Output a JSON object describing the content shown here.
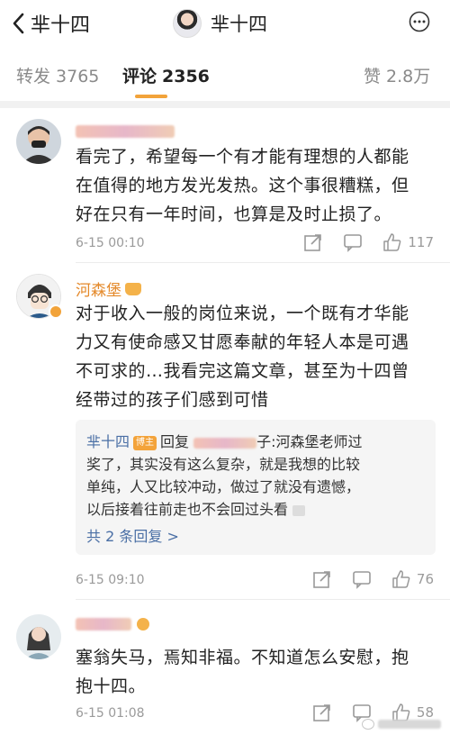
{
  "header": {
    "back_label": "芈十四",
    "title": "芈十四"
  },
  "tabs": [
    {
      "label": "转发",
      "count": "3765"
    },
    {
      "label": "评论",
      "count": "2356"
    },
    {
      "label": "赞",
      "count": "2.8万"
    }
  ],
  "comments": [
    {
      "username": "",
      "text_lines": [
        "看完了，希望每一个有才能有理想的人都能",
        "在值得的地方发光发热。这个事很糟糕，但",
        "好在只有一年时间，也算是及时止损了。"
      ],
      "time": "6-15 00:10",
      "likes": "117"
    },
    {
      "username": "河森堡",
      "text_lines": [
        "对于收入一般的岗位来说，一个既有才华能",
        "力又有使命感又甘愿奉献的年轻人本是可遇",
        "不可求的…我看完这篇文章，甚至为十四曾",
        "经带过的孩子们感到可惜"
      ],
      "time": "6-15 09:10",
      "likes": "76",
      "reply": {
        "author": "芈十四",
        "badge": "博主",
        "prefix": "回复",
        "target_suffix": "子:",
        "line1": "河森堡老师过",
        "lines": [
          "奖了，其实没有这么复杂，就是我想的比较",
          "单纯，人又比较冲动，做过了就没有遗憾，",
          "以后接着往前走也不会回过头看"
        ],
        "more": "共 2 条回复 >"
      }
    },
    {
      "username": "",
      "text_lines": [
        "塞翁失马，焉知非福。不知道怎么安慰，抱",
        "抱十四。"
      ],
      "time": "6-15 01:08",
      "likes": "58"
    }
  ],
  "colors": {
    "accent": "#f2a33a",
    "link": "#4a6fa5",
    "muted": "#9a9a9a"
  },
  "icons": [
    "back-icon",
    "more-icon",
    "share-icon",
    "comment-icon",
    "like-icon"
  ]
}
